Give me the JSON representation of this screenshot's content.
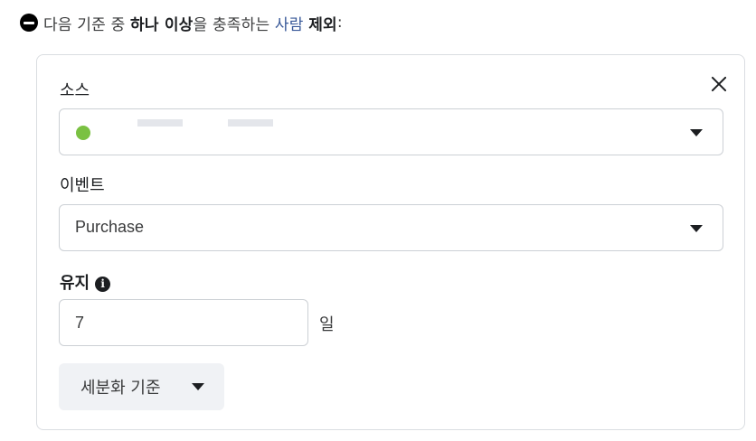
{
  "header": {
    "prefix": "다음 기준 중 ",
    "emphasis": "하나 이상",
    "middle": "을 충족하는 ",
    "link": "사람",
    "space": " ",
    "suffix": "제외",
    "colon": ":"
  },
  "source": {
    "label": "소스",
    "status_color": "#7ac142"
  },
  "event": {
    "label": "이벤트",
    "value": "Purchase"
  },
  "retention": {
    "label": "유지",
    "info_glyph": "i",
    "value": "7",
    "unit": "일"
  },
  "refine_button": {
    "label": "세분화 기준"
  },
  "icons": {
    "exclude": "minus-circle-icon",
    "close": "close-icon",
    "dropdown": "caret-down-icon",
    "info": "info-icon",
    "status": "status-dot-icon"
  }
}
